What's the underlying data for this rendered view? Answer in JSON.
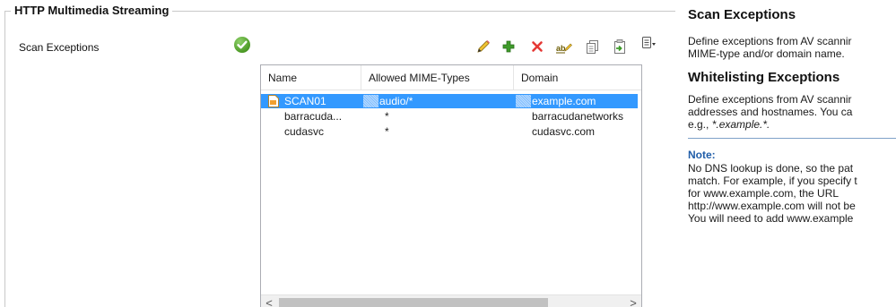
{
  "group": {
    "title": "HTTP Multimedia Streaming"
  },
  "setting": {
    "label": "Scan Exceptions",
    "status_icon": "check-circle-icon"
  },
  "toolbar": {
    "buttons": [
      {
        "name": "edit",
        "icon": "pencil-icon"
      },
      {
        "name": "add",
        "icon": "plus-icon"
      },
      {
        "name": "delete",
        "icon": "delete-x-icon"
      },
      {
        "name": "rename",
        "icon": "rename-icon"
      },
      {
        "name": "copy",
        "icon": "copy-icon"
      },
      {
        "name": "paste",
        "icon": "paste-icon"
      },
      {
        "name": "menu",
        "icon": "list-menu-icon"
      }
    ]
  },
  "table": {
    "columns": [
      "Name",
      "Allowed MIME-Types",
      "Domain"
    ],
    "rows": [
      {
        "name": "SCAN01",
        "mime": "audio/*",
        "domain": "example.com",
        "selected": true
      },
      {
        "name": "barracuda...",
        "mime": "*",
        "domain": "barracudanetworks",
        "selected": false
      },
      {
        "name": "cudasvc",
        "mime": "*",
        "domain": "cudasvc.com",
        "selected": false
      }
    ],
    "scroll_left": "<",
    "scroll_right": ">"
  },
  "help": {
    "scan_title": "Scan Exceptions",
    "scan_line1": "Define exceptions from AV scannir",
    "scan_line2": "MIME-type and/or domain name.",
    "white_title": "Whitelisting Exceptions",
    "white_line1": "Define exceptions from AV scannir",
    "white_line2": "addresses and hostnames. You ca",
    "white_line3_prefix": "e.g., ",
    "white_line3_example": "*.example.*.",
    "note_title": "Note:",
    "note_lines": [
      "No DNS lookup is done, so the pat",
      "match. For example, if you specify t",
      "for www.example.com, the URL",
      "http://www.example.com will not be",
      "You will need to add www.example"
    ]
  },
  "colors": {
    "selection": "#3399ff",
    "note_accent": "#1f5da8",
    "ok_green": "#4c9a25"
  }
}
